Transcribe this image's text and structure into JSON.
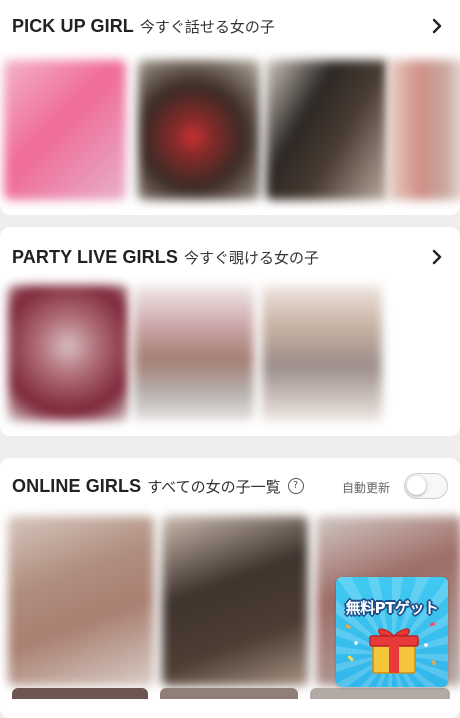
{
  "pickup": {
    "title_en": "PICK UP GIRL",
    "title_jp": "今すぐ話せる女の子"
  },
  "party": {
    "title_en": "PARTY LIVE GIRLS",
    "title_jp": "今すぐ覗ける女の子"
  },
  "online": {
    "title_en": "ONLINE GIRLS",
    "title_jp": "すべての女の子一覧",
    "help_icon": "?",
    "auto_refresh_label": "自動更新",
    "auto_refresh_on": false
  },
  "promo": {
    "label": "無料PTゲット"
  },
  "icons": {
    "chevron": "chevron-right-icon",
    "help": "question-circle-icon",
    "gift": "gift-box-icon"
  },
  "colors": {
    "background": "#eeeeee",
    "card": "#ffffff",
    "promo_blue": "#3bbdef",
    "promo_outline": "#1b4e8a"
  }
}
